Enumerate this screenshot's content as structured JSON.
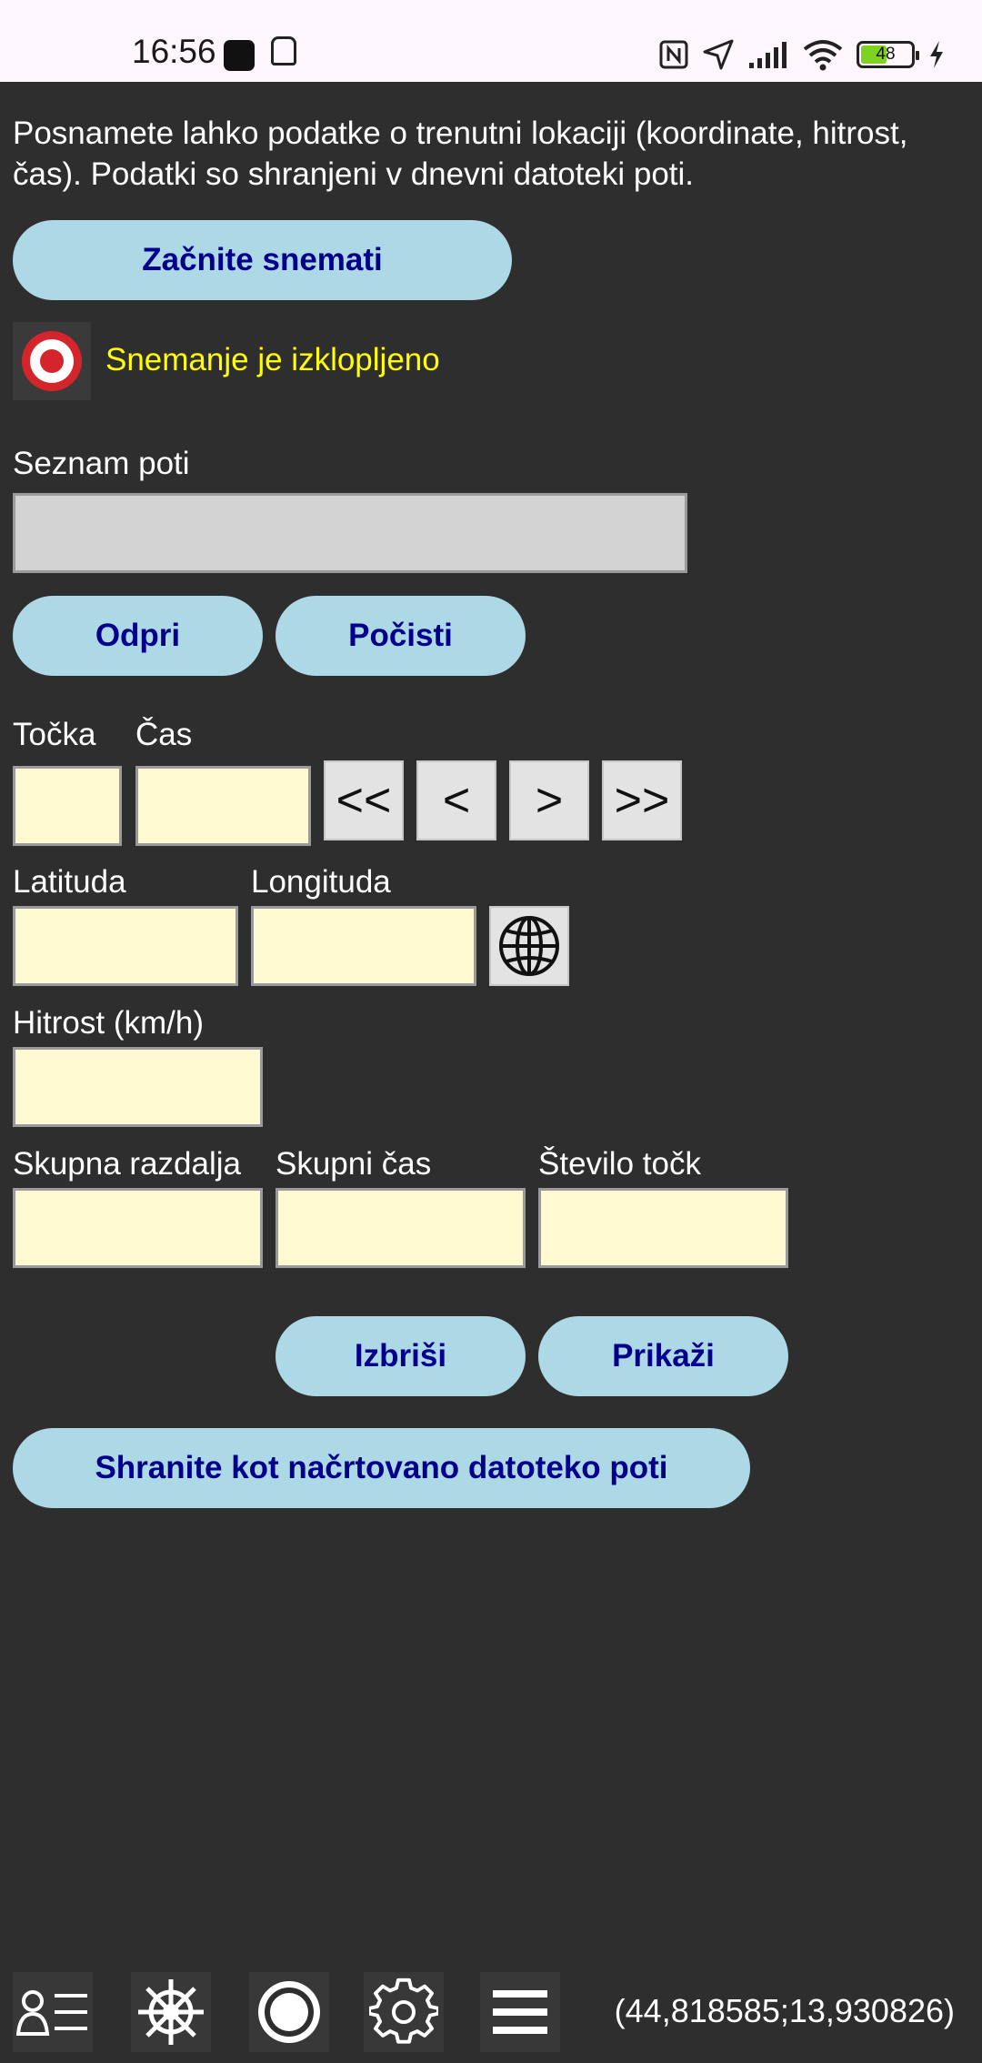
{
  "status_bar": {
    "time": "16:56",
    "battery": "48"
  },
  "intro_text": "Posnamete lahko podatke o trenutni lokaciji (koordinate, hitrost, čas). Podatki so shranjeni v dnevni datoteki poti.",
  "recording": {
    "start_button": "Začnite snemati",
    "status": "Snemanje je izklopljeno",
    "status_color": "#ffff00"
  },
  "track_list": {
    "label": "Seznam poti",
    "open_button": "Odpri",
    "clear_button": "Počisti"
  },
  "point": {
    "point_label": "Točka",
    "time_label": "Čas",
    "first": "<<",
    "prev": "<",
    "next": ">",
    "last": ">>"
  },
  "position": {
    "lat_label": "Latituda",
    "lon_label": "Longituda"
  },
  "speed": {
    "label": "Hitrost (km/h)"
  },
  "totals": {
    "distance_label": "Skupna razdalja",
    "time_label": "Skupni čas",
    "count_label": "Število točk"
  },
  "actions": {
    "delete_button": "Izbriši",
    "show_button": "Prikaži",
    "save_button": "Shranite kot načrtovano datoteko poti"
  },
  "bottom_bar": {
    "coordinates": "(44,818585;13,930826)",
    "icons": [
      "contacts-list-icon",
      "helm-icon",
      "record-icon",
      "gear-icon",
      "menu-icon"
    ]
  },
  "colors": {
    "background": "#2e2e2e",
    "button": "#add8e6",
    "button_text": "#00008b",
    "field": "#fffad2"
  }
}
